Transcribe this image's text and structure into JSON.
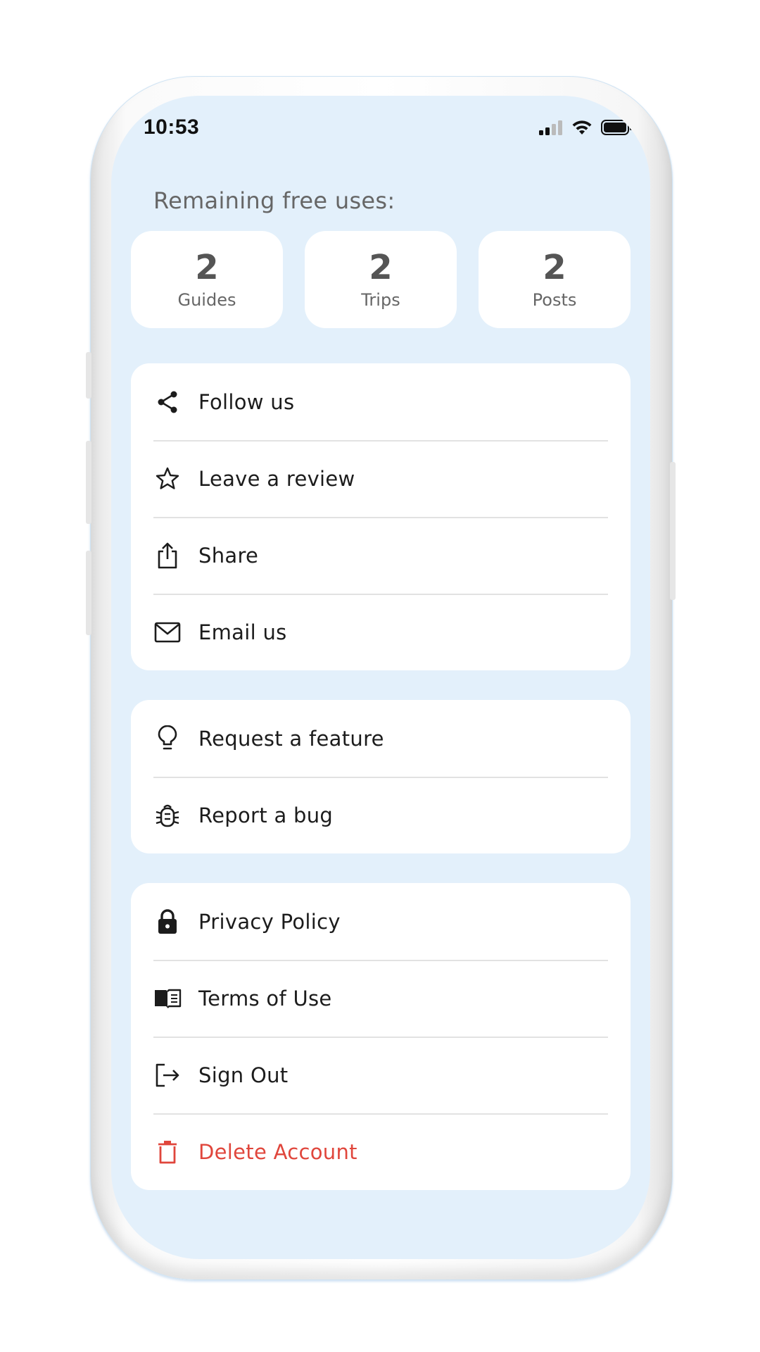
{
  "status_bar": {
    "time": "10:53",
    "icons": [
      "cellular-signal-icon",
      "wifi-icon",
      "battery-icon"
    ]
  },
  "usage": {
    "title": "Remaining free uses:",
    "stats": [
      {
        "value": "2",
        "label": "Guides"
      },
      {
        "value": "2",
        "label": "Trips"
      },
      {
        "value": "2",
        "label": "Posts"
      }
    ]
  },
  "menu": {
    "social": [
      {
        "icon": "share-nodes-icon",
        "label": "Follow us"
      },
      {
        "icon": "star-icon",
        "label": "Leave a review"
      },
      {
        "icon": "share-upload-icon",
        "label": "Share"
      },
      {
        "icon": "mail-icon",
        "label": "Email us"
      }
    ],
    "feedback": [
      {
        "icon": "lightbulb-icon",
        "label": "Request a feature"
      },
      {
        "icon": "bug-icon",
        "label": "Report a bug"
      }
    ],
    "account": [
      {
        "icon": "lock-icon",
        "label": "Privacy Policy"
      },
      {
        "icon": "book-icon",
        "label": "Terms of Use"
      },
      {
        "icon": "sign-out-icon",
        "label": "Sign Out"
      },
      {
        "icon": "trash-icon",
        "label": "Delete Account"
      }
    ]
  },
  "colors": {
    "screen_background": "#e3f0fb",
    "card_background": "#ffffff",
    "danger": "#e0463c",
    "text_primary": "#1c1c1c",
    "text_muted": "#666666"
  }
}
